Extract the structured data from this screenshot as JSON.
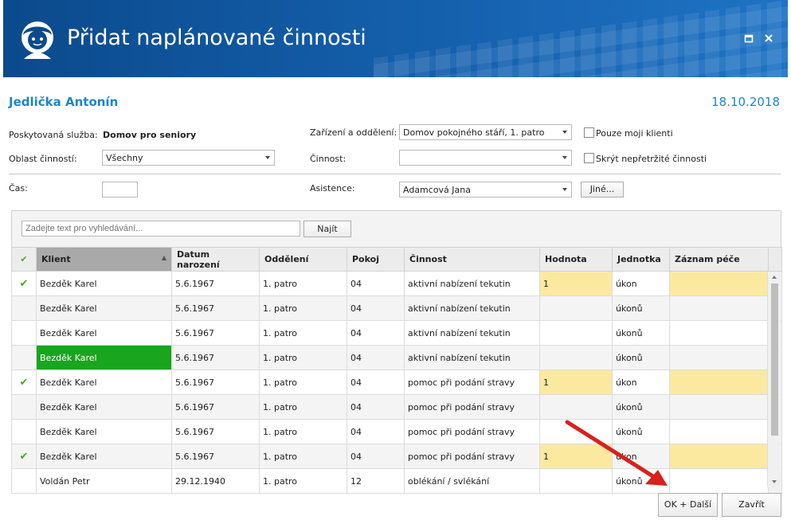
{
  "window": {
    "title": "Přidat naplánované činnosti",
    "maximize_icon": "maximize-icon",
    "close_icon": "close-icon"
  },
  "header": {
    "client_name": "Jedlička Antonín",
    "date": "18.10.2018"
  },
  "form": {
    "service_label": "Poskytovaná služba:",
    "service_value": "Domov pro seniory",
    "area_label": "Oblast činností:",
    "area_value": "Všechny",
    "time_label": "Čas:",
    "facility_label": "Zařízení a oddělení:",
    "facility_value": "Domov pokojného stáří, 1. patro",
    "activity_label": "Činnost:",
    "activity_value": "",
    "assistance_label": "Asistence:",
    "assistance_value": "Adamcová Jana",
    "other_button": "Jiné...",
    "only_my_clients": "Pouze moji klienti",
    "hide_continuous": "Skrýt nepřetržité činnosti"
  },
  "search": {
    "placeholder": "Zadejte text pro vyhledávání...",
    "button": "Najít"
  },
  "table": {
    "columns": [
      "",
      "Klient",
      "Datum narození",
      "Oddělení",
      "Pokoj",
      "Činnost",
      "Hodnota",
      "Jednotka",
      "Záznam péče"
    ],
    "rows": [
      {
        "checked": true,
        "client": "Bezděk Karel",
        "dob": "5.6.1967",
        "dept": "1. patro",
        "room": "04",
        "activity": "aktivní nabízení tekutin",
        "value": "1",
        "unit": "úkon"
      },
      {
        "checked": false,
        "client": "Bezděk Karel",
        "dob": "5.6.1967",
        "dept": "1. patro",
        "room": "04",
        "activity": "aktivní nabízení tekutin",
        "value": "",
        "unit": "úkonů"
      },
      {
        "checked": false,
        "client": "Bezděk Karel",
        "dob": "5.6.1967",
        "dept": "1. patro",
        "room": "04",
        "activity": "aktivní nabízení tekutin",
        "value": "",
        "unit": "úkonů"
      },
      {
        "checked": false,
        "client": "Bezděk Karel",
        "dob": "5.6.1967",
        "dept": "1. patro",
        "room": "04",
        "activity": "aktivní nabízení tekutin",
        "value": "",
        "unit": "úkonů"
      },
      {
        "checked": true,
        "client": "Bezděk Karel",
        "dob": "5.6.1967",
        "dept": "1. patro",
        "room": "04",
        "activity": "pomoc při podání stravy",
        "value": "1",
        "unit": "úkon"
      },
      {
        "checked": false,
        "client": "Bezděk Karel",
        "dob": "5.6.1967",
        "dept": "1. patro",
        "room": "04",
        "activity": "pomoc při podání stravy",
        "value": "",
        "unit": "úkonů"
      },
      {
        "checked": false,
        "client": "Bezděk Karel",
        "dob": "5.6.1967",
        "dept": "1. patro",
        "room": "04",
        "activity": "pomoc při podání stravy",
        "value": "",
        "unit": "úkonů"
      },
      {
        "checked": true,
        "client": "Bezděk Karel",
        "dob": "5.6.1967",
        "dept": "1. patro",
        "room": "04",
        "activity": "pomoc při podání stravy",
        "value": "1",
        "unit": "úkon"
      },
      {
        "checked": false,
        "client": "Voldán Petr",
        "dob": "29.12.1940",
        "dept": "1. patro",
        "room": "12",
        "activity": "oblékání / svlékání",
        "value": "",
        "unit": "úkonů"
      }
    ]
  },
  "footer": {
    "ok_next": "OK + Další",
    "close": "Zavřít"
  },
  "colors": {
    "title_bar": "#1560ad",
    "accent_text": "#1b86c8",
    "highlight_yellow": "#fbe9a0",
    "selected_green": "#19a51e",
    "annotation_arrow": "#d8201c"
  },
  "icons": {
    "logo": "user-avatar-icon",
    "check": "check-icon",
    "sort": "sort-ascending-icon"
  }
}
